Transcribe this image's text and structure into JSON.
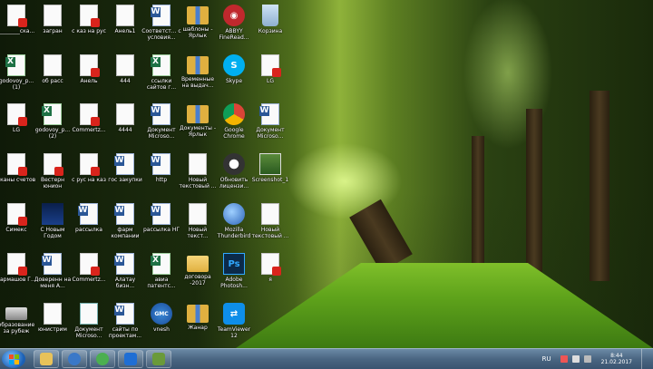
{
  "desktop_icons": [
    {
      "label": "________ска...",
      "type": "pdf",
      "col": 0,
      "row": 0
    },
    {
      "label": "загран",
      "type": "doc",
      "col": 1,
      "row": 0
    },
    {
      "label": "с каз на рус",
      "type": "pdf",
      "col": 2,
      "row": 0
    },
    {
      "label": "Анель1",
      "type": "doc",
      "col": 3,
      "row": 0
    },
    {
      "label": "Соответст... с условия...",
      "type": "word",
      "col": 4,
      "row": 0
    },
    {
      "label": "шаблоны - Ярлык",
      "type": "zip",
      "col": 5,
      "row": 0
    },
    {
      "label": "ABBYY FineRead...",
      "type": "abbyy",
      "col": 6,
      "row": 0
    },
    {
      "label": "Корзина",
      "type": "bin",
      "col": 7,
      "row": 0
    },
    {
      "label": "godovoy_p... (1)",
      "type": "excel",
      "col": 0,
      "row": 1
    },
    {
      "label": "об расс",
      "type": "doc",
      "col": 1,
      "row": 1
    },
    {
      "label": "Анель",
      "type": "pdf",
      "col": 2,
      "row": 1
    },
    {
      "label": "444",
      "type": "doc",
      "col": 3,
      "row": 1
    },
    {
      "label": "ссылки сайтов г...",
      "type": "excel",
      "col": 4,
      "row": 1
    },
    {
      "label": "Временные на выдач...",
      "type": "zip",
      "col": 5,
      "row": 1
    },
    {
      "label": "Skype",
      "type": "skype",
      "col": 6,
      "row": 1
    },
    {
      "label": "LG",
      "type": "pdf",
      "col": 7,
      "row": 1
    },
    {
      "label": "LG",
      "type": "pdf",
      "col": 0,
      "row": 2
    },
    {
      "label": "godovoy_p... (2)",
      "type": "excel",
      "col": 1,
      "row": 2
    },
    {
      "label": "Commertz...",
      "type": "pdf",
      "col": 2,
      "row": 2
    },
    {
      "label": "4444",
      "type": "doc",
      "col": 3,
      "row": 2
    },
    {
      "label": "Документ Microso...",
      "type": "word",
      "col": 4,
      "row": 2
    },
    {
      "label": "Документы - Ярлык",
      "type": "zip",
      "col": 5,
      "row": 2
    },
    {
      "label": "Google Chrome",
      "type": "chrome",
      "col": 6,
      "row": 2
    },
    {
      "label": "Документ Microso...",
      "type": "word",
      "col": 7,
      "row": 2
    },
    {
      "label": "сканы счетов",
      "type": "pdf",
      "col": 0,
      "row": 3
    },
    {
      "label": "Вестерн юнион",
      "type": "pdf",
      "col": 1,
      "row": 3
    },
    {
      "label": "с рус на каз",
      "type": "pdf",
      "col": 2,
      "row": 3
    },
    {
      "label": "гос закупки",
      "type": "word",
      "col": 3,
      "row": 3
    },
    {
      "label": "http",
      "type": "word",
      "col": 4,
      "row": 3
    },
    {
      "label": "Новый текстовый ...",
      "type": "doc",
      "col": 5,
      "row": 3
    },
    {
      "label": "Обновить лицензи...",
      "type": "update",
      "col": 6,
      "row": 3
    },
    {
      "label": "Screenshot_1",
      "type": "shot",
      "col": 7,
      "row": 3
    },
    {
      "label": "Симекс",
      "type": "pdf",
      "col": 0,
      "row": 4
    },
    {
      "label": "С Новым Годом",
      "type": "tree",
      "col": 1,
      "row": 4
    },
    {
      "label": "рассылка",
      "type": "word",
      "col": 2,
      "row": 4
    },
    {
      "label": "фарм компании",
      "type": "word",
      "col": 3,
      "row": 4
    },
    {
      "label": "рассылка НГ",
      "type": "word",
      "col": 4,
      "row": 4
    },
    {
      "label": "Новый текст...",
      "type": "doc",
      "col": 5,
      "row": 4
    },
    {
      "label": "Mozilla Thunderbird",
      "type": "thunderbird",
      "col": 6,
      "row": 4
    },
    {
      "label": "Новый текстовый ...",
      "type": "doc",
      "col": 7,
      "row": 4
    },
    {
      "label": "Гармашов Г...",
      "type": "pdf",
      "col": 0,
      "row": 5
    },
    {
      "label": "Доверенн на меня А...",
      "type": "word",
      "col": 1,
      "row": 5
    },
    {
      "label": "Commertz...",
      "type": "pdf",
      "col": 2,
      "row": 5
    },
    {
      "label": "Алатау бизн...",
      "type": "word",
      "col": 3,
      "row": 5
    },
    {
      "label": "авиа патентс...",
      "type": "excel",
      "col": 4,
      "row": 5
    },
    {
      "label": "договора -2017",
      "type": "folder",
      "col": 5,
      "row": 5
    },
    {
      "label": "Adobe Photosh...",
      "type": "ps",
      "col": 6,
      "row": 5
    },
    {
      "label": "я",
      "type": "pdf",
      "col": 7,
      "row": 5
    },
    {
      "label": "образование за рубеж",
      "type": "scanner",
      "col": 0,
      "row": 6
    },
    {
      "label": "юнистрим",
      "type": "doc",
      "col": 1,
      "row": 6
    },
    {
      "label": "Документ Microso...",
      "type": "publisher",
      "col": 2,
      "row": 6
    },
    {
      "label": "сайты по проектам...",
      "type": "word",
      "col": 3,
      "row": 6
    },
    {
      "label": "vnesh",
      "type": "gmc",
      "col": 4,
      "row": 6
    },
    {
      "label": "Жанар",
      "type": "zip",
      "col": 5,
      "row": 6
    },
    {
      "label": "TeamViewer 12",
      "type": "teamviewer",
      "col": 6,
      "row": 6
    }
  ],
  "taskbar": {
    "pinned": [
      {
        "name": "explorer",
        "color": "#e8c25a"
      },
      {
        "name": "thunderbird",
        "color": "#3a78c8"
      },
      {
        "name": "chrome",
        "color": "#4caf50"
      },
      {
        "name": "teamviewer",
        "color": "#1f6ed4"
      },
      {
        "name": "screenshot",
        "color": "#6a9a3a"
      }
    ],
    "language": "RU",
    "time": "8:44",
    "date": "21.02.2017"
  }
}
